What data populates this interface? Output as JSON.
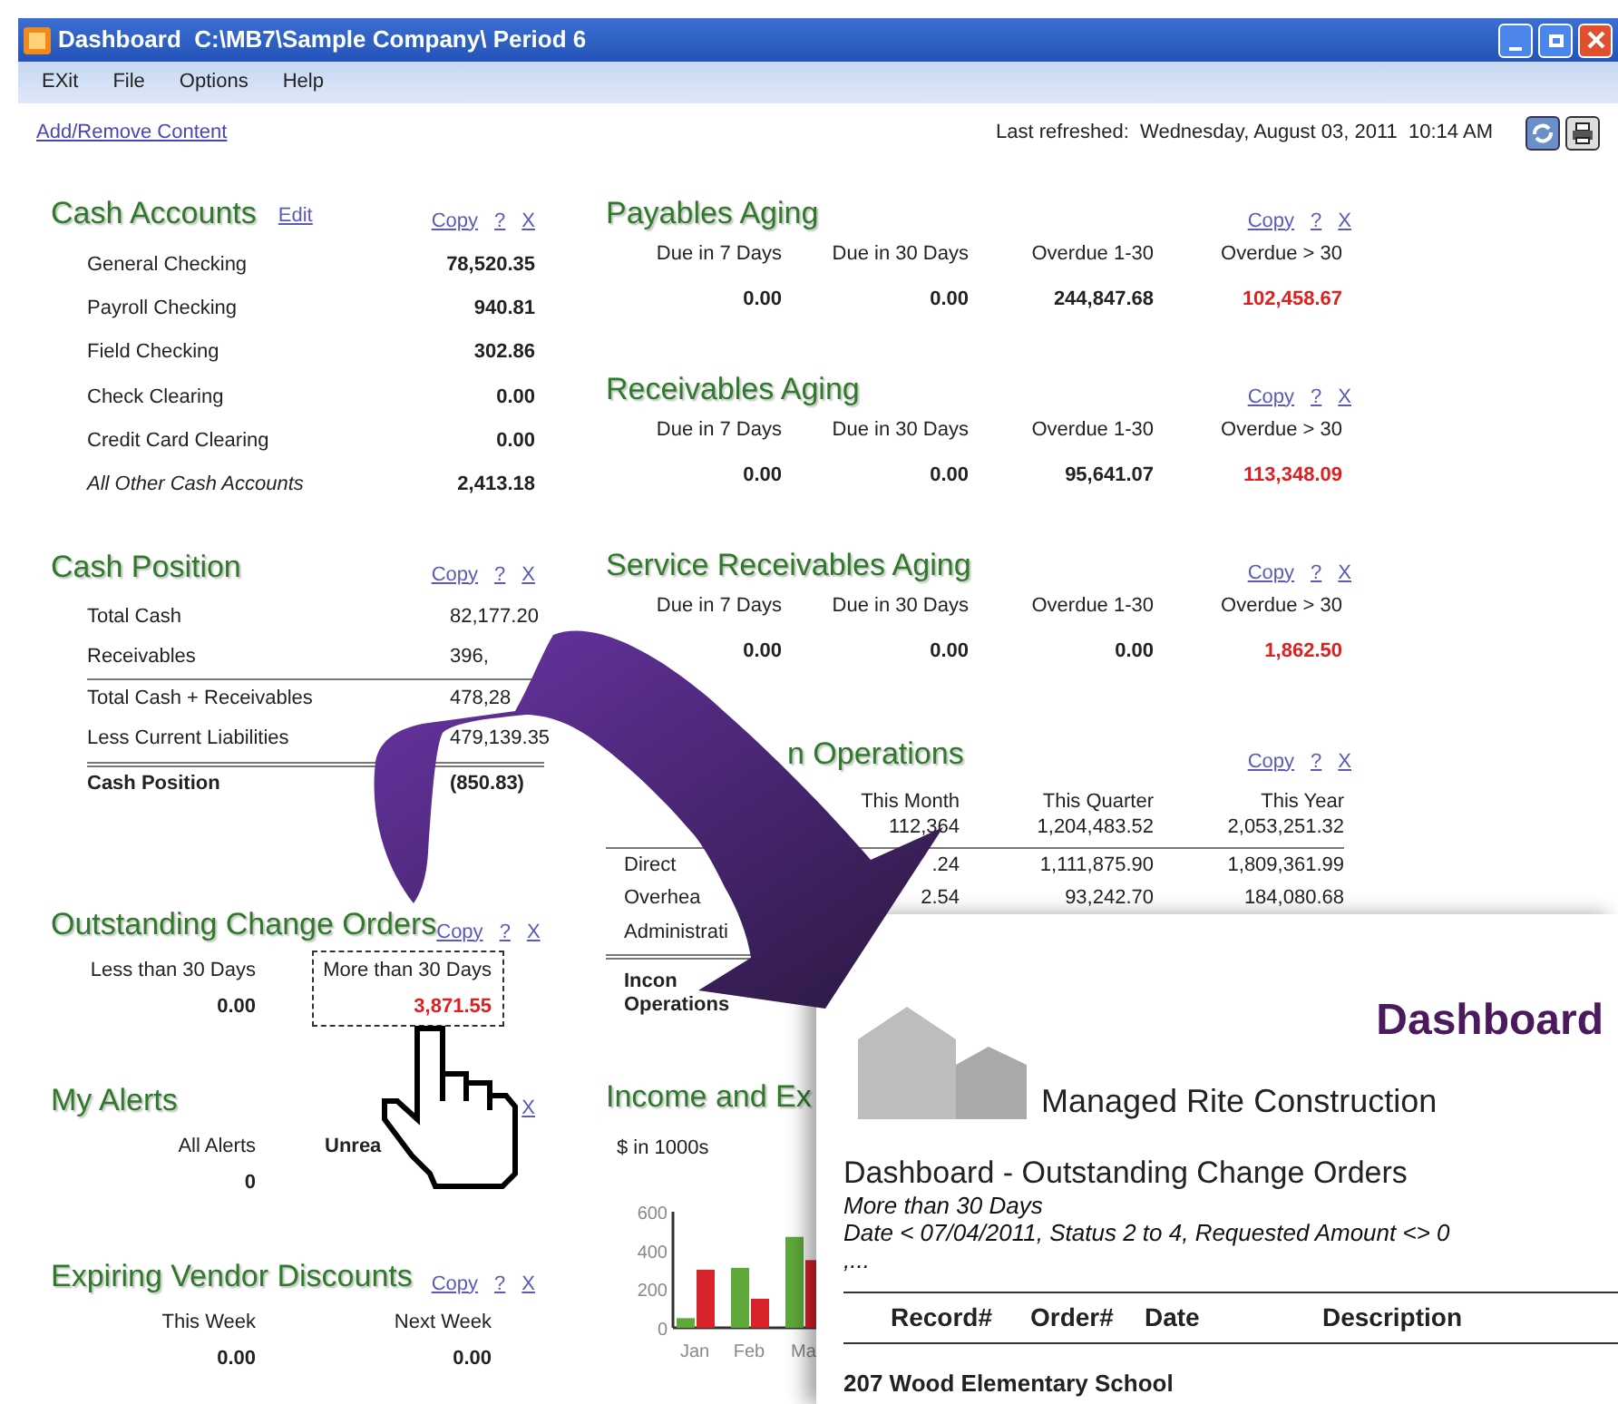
{
  "window": {
    "title": "Dashboard  C:\\MB7\\Sample Company\\ Period 6"
  },
  "menu": [
    "EXit",
    "File",
    "Options",
    "Help"
  ],
  "toolbar": {
    "link": "Add/Remove Content",
    "last_refreshed": "Last refreshed:  Wednesday, August 03, 2011  10:14 AM"
  },
  "left_column": [
    {
      "kind": "list",
      "title": "Cash Accounts",
      "edit": "Edit",
      "links": [
        "Copy",
        "?",
        "X"
      ],
      "rows": [
        {
          "label": "General Checking",
          "value": "78,520.35",
          "italic": false,
          "bold_label": false,
          "bold_value": true
        },
        {
          "label": "Payroll Checking",
          "value": "940.81",
          "italic": false,
          "bold_label": false,
          "bold_value": true
        },
        {
          "label": "Field Checking",
          "value": "302.86",
          "italic": false,
          "bold_label": false,
          "bold_value": true
        },
        {
          "label": "Check Clearing",
          "value": "0.00",
          "italic": false,
          "bold_label": false,
          "bold_value": true
        },
        {
          "label": "Credit Card Clearing",
          "value": "0.00",
          "italic": false,
          "bold_label": false,
          "bold_value": true
        },
        {
          "label": "All Other Cash Accounts",
          "value": "2,413.18",
          "italic": true,
          "bold_label": false,
          "bold_value": true
        }
      ]
    },
    {
      "kind": "list",
      "title": "Cash Position",
      "links": [
        "Copy",
        "?",
        "X"
      ],
      "rows": [
        {
          "label": "Total Cash",
          "value": "82,177.20",
          "italic": false,
          "bold_label": false,
          "bold_value": false,
          "rule_above": false,
          "double_rule_above": false
        },
        {
          "label": "Receivables",
          "value": "396,",
          "italic": false,
          "bold_label": false,
          "bold_value": false,
          "rule_above": false,
          "double_rule_above": false
        },
        {
          "label": "Total Cash + Receivables",
          "value": "478,28",
          "italic": false,
          "bold_label": false,
          "bold_value": false,
          "rule_above": true,
          "double_rule_above": false
        },
        {
          "label": "Less Current Liabilities",
          "value": "479,139.35",
          "italic": false,
          "bold_label": false,
          "bold_value": false,
          "rule_above": false,
          "double_rule_above": false
        },
        {
          "label": "Cash Position",
          "value": "(850.83)",
          "italic": false,
          "bold_label": true,
          "bold_value": true,
          "rule_above": false,
          "double_rule_above": true
        }
      ]
    },
    {
      "kind": "columns",
      "title": "Outstanding Change Orders",
      "links": [
        "Copy",
        "?",
        "X"
      ],
      "columns": [
        {
          "header": "Less than 30 Days",
          "value": "0.00",
          "alert": false,
          "focused": false
        },
        {
          "header": "More than 30 Days",
          "value": "3,871.55",
          "alert": true,
          "focused": true
        }
      ]
    },
    {
      "kind": "columns",
      "title": "My Alerts",
      "links": [
        "X"
      ],
      "columns": [
        {
          "header": "All Alerts",
          "value": "0",
          "alert": false
        },
        {
          "header": "Unrea",
          "bold": true
        }
      ]
    },
    {
      "kind": "columns",
      "title": "Expiring Vendor Discounts",
      "links": [
        "Copy",
        "?",
        "X"
      ],
      "columns": [
        {
          "header": "This Week",
          "value": "0.00",
          "alert": false
        },
        {
          "header": "Next Week",
          "value": "0.00",
          "alert": false
        }
      ]
    }
  ],
  "middle_column": [
    {
      "kind": "aging",
      "title": "Payables Aging",
      "links": [
        "Copy",
        "?",
        "X"
      ],
      "columns": [
        {
          "header": "Due in 7 Days",
          "value": "0.00",
          "alert": false
        },
        {
          "header": "Due in 30 Days",
          "value": "0.00",
          "alert": false
        },
        {
          "header": "Overdue 1-30",
          "value": "244,847.68",
          "alert": false
        },
        {
          "header": "Overdue > 30",
          "value": "102,458.67",
          "alert": true
        }
      ]
    },
    {
      "kind": "aging",
      "title": "Receivables Aging",
      "links": [
        "Copy",
        "?",
        "X"
      ],
      "columns": [
        {
          "header": "Due in 7 Days",
          "value": "0.00",
          "alert": false
        },
        {
          "header": "Due in 30 Days",
          "value": "0.00",
          "alert": false
        },
        {
          "header": "Overdue 1-30",
          "value": "95,641.07",
          "alert": false
        },
        {
          "header": "Overdue > 30",
          "value": "113,348.09",
          "alert": true
        }
      ]
    },
    {
      "kind": "aging",
      "title": "Service Receivables Aging",
      "links": [
        "Copy",
        "?",
        "X"
      ],
      "columns": [
        {
          "header": "Due in 7 Days",
          "value": "0.00",
          "alert": false
        },
        {
          "header": "Due in 30 Days",
          "value": "0.00",
          "alert": false
        },
        {
          "header": "Overdue 1-30",
          "value": "0.00",
          "alert": false
        },
        {
          "header": "Overdue > 30",
          "value": "1,862.50",
          "alert": true
        }
      ]
    },
    {
      "kind": "table",
      "title": "n Operations",
      "links": [
        "Copy",
        "?",
        "X"
      ],
      "headers": [
        "This Month",
        "This Quarter",
        "This Year"
      ],
      "rows": [
        {
          "values": [
            "112,364",
            "1,204,483.52",
            "2,053,251.32"
          ],
          "bold": false,
          "rule_above": false,
          "double_rule_above": false
        },
        {
          "label": "Direct",
          "values": [
            ".24",
            "1,111,875.90",
            "1,809,361.99"
          ],
          "bold": false,
          "rule_above": true,
          "double_rule_above": false
        },
        {
          "label": "Overhea",
          "values": [
            "2.54",
            "93,242.70",
            "184,080.68"
          ],
          "bold": false,
          "rule_above": false,
          "double_rule_above": false
        },
        {
          "label": "Administrati",
          "bold": false,
          "rule_above": false,
          "double_rule_above": false
        },
        {
          "label": "Incon\nOperations",
          "bold": true,
          "rule_above": false,
          "double_rule_above": true
        }
      ]
    },
    {
      "kind": "chart",
      "title": "Income and Ex",
      "unit": "$ in 1000s",
      "chart_data": {
        "type": "bar",
        "categories": [
          "Jan",
          "Feb",
          "Ma"
        ],
        "series": [
          {
            "color": "#5fa83a",
            "values": [
              50,
              310,
              470
            ]
          },
          {
            "color": "#d8232a",
            "values": [
              300,
              150,
              350
            ]
          }
        ],
        "yticks": [
          0,
          200,
          400,
          600
        ],
        "ylim": [
          0,
          600
        ]
      }
    }
  ],
  "report": {
    "heading": "Dashboard",
    "company": "Managed Rite Construction",
    "title": "Dashboard - Outstanding Change Orders",
    "subtitle": "More than 30 Days",
    "criteria": "Date < 07/04/2011, Status 2 to 4, Requested Amount <> 0 ,...",
    "columns": [
      "Record#",
      "Order#",
      "Date",
      "Description"
    ],
    "group": "207 Wood Elementary School"
  }
}
